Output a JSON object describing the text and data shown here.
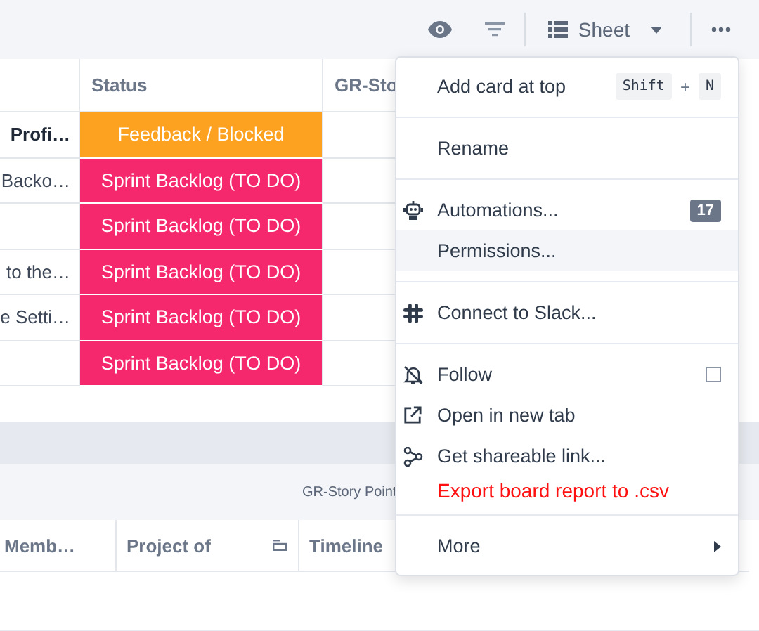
{
  "toolbar": {
    "view_label": "Sheet"
  },
  "table": {
    "columns": [
      {},
      {
        "label": "Status"
      },
      {
        "label": "GR-Sto"
      }
    ],
    "rows": [
      {
        "title": "Profi…",
        "bold": true,
        "status": "Feedback / Blocked",
        "color": "#fca120"
      },
      {
        "title": "Backo…",
        "bold": false,
        "status": "Sprint Backlog (TO DO)",
        "color": "#f5286e"
      },
      {
        "status": "Sprint Backlog (TO DO)",
        "color": "#f5286e"
      },
      {
        "title": "to the…",
        "bold": false,
        "status": "Sprint Backlog (TO DO)",
        "color": "#f5286e"
      },
      {
        "title": "e Setti…",
        "bold": false,
        "status": "Sprint Backlog (TO DO)",
        "color": "#f5286e"
      },
      {
        "status": "Sprint Backlog (TO DO)",
        "color": "#f5286e"
      }
    ]
  },
  "second_table": {
    "group_label": "GR-Story Point",
    "columns": [
      {
        "label": "Memb…",
        "icon": false
      },
      {
        "label": "Project of",
        "icon": true
      },
      {
        "label": "Timeline"
      }
    ]
  },
  "menu": {
    "sections": [
      {
        "items": [
          {
            "kind": "shortcut",
            "label": "Add card at top",
            "keys": [
              "Shift",
              "N"
            ],
            "joiner": "+",
            "hovered": false
          }
        ]
      },
      {
        "items": [
          {
            "kind": "plain",
            "label": "Rename",
            "hovered": false
          }
        ]
      },
      {
        "items": [
          {
            "kind": "robot",
            "label": "Automations...",
            "badge": "17",
            "hovered": false
          },
          {
            "kind": "plain",
            "label": "Permissions...",
            "hovered": true
          }
        ]
      },
      {
        "items": [
          {
            "kind": "slack",
            "label": "Connect to Slack...",
            "hovered": false
          }
        ]
      },
      {
        "items": [
          {
            "kind": "follow",
            "label": "Follow",
            "checked": false,
            "hovered": false
          },
          {
            "kind": "external",
            "label": "Open in new tab",
            "hovered": false
          },
          {
            "kind": "share",
            "label": "Get shareable link...",
            "hovered": false
          },
          {
            "kind": "notice",
            "label": "Export board report to .csv",
            "hovered": false
          }
        ]
      },
      {
        "items": [
          {
            "kind": "submenu",
            "label": "More",
            "hovered": false
          }
        ]
      }
    ]
  }
}
